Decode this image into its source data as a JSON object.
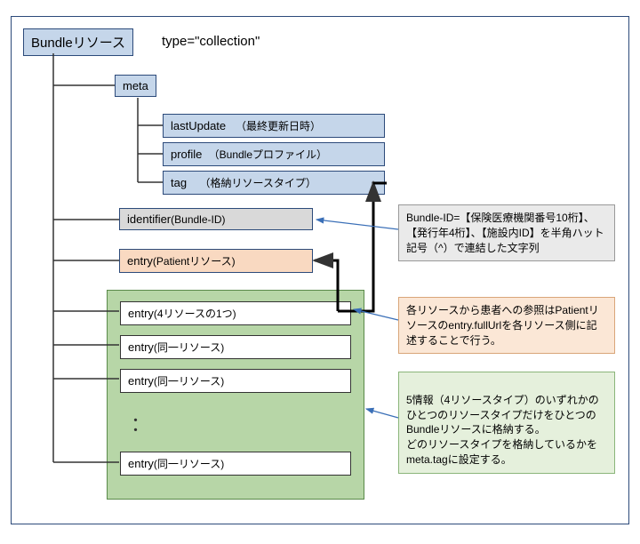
{
  "root": {
    "title": "Bundleリソース",
    "type_label": "type=\"collection\""
  },
  "meta": {
    "label": "meta",
    "lastUpdate": {
      "name": "lastUpdate",
      "desc": "（最終更新日時）"
    },
    "profile": {
      "name": "profile",
      "desc": "（Bundleプロファイル）"
    },
    "tag": {
      "name": "tag",
      "desc": "（格納リソースタイプ）"
    }
  },
  "identifier": {
    "name": "identifier",
    "desc": "(Bundle-ID)"
  },
  "patientEntry": {
    "name": "entry",
    "desc": "(Patientリソース)"
  },
  "group": {
    "entry1": {
      "name": "entry",
      "desc": "(4リソースの1つ)"
    },
    "entry2": {
      "name": "entry",
      "desc": "(同一リソース)"
    },
    "entry3": {
      "name": "entry",
      "desc": "(同一リソース)"
    },
    "ellipsis": "：",
    "entryN": {
      "name": "entry",
      "desc": "(同一リソース)"
    }
  },
  "notes": {
    "bundleId": "Bundle-ID=【保険医療機関番号10桁】、【発行年4桁】、【施設内ID】を半角ハット記号（^）で連結した文字列",
    "patientRef": "各リソースから患者への参照はPatientリソースのentry.fullUrlを各リソース側に記述することで行う。",
    "fiveInfo": "5情報（4リソースタイプ）のいずれかのひとつのリソースタイプだけをひとつのBundleリソースに格納する。\nどのリソースタイプを格納しているかをmeta.tagに設定する。"
  }
}
